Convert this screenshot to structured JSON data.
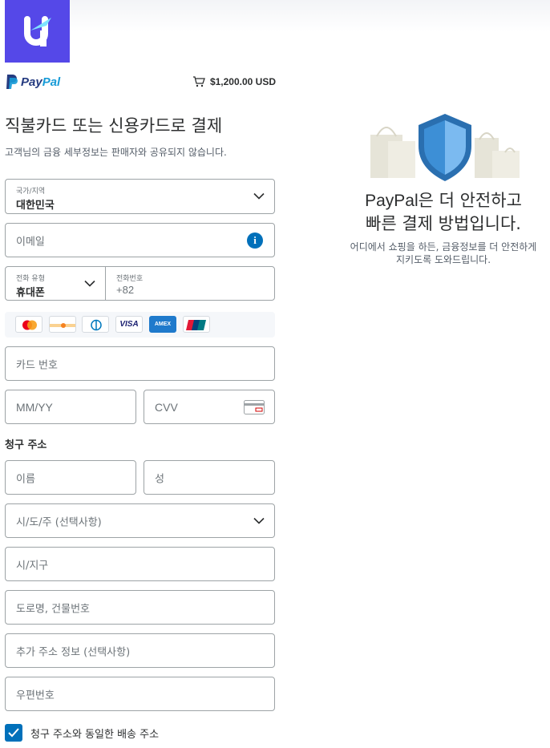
{
  "brand": {
    "logo_icon": "u-logo-icon",
    "accent": "#5548e8"
  },
  "paypal": {
    "logo_text_a": "Pay",
    "logo_text_b": "Pal",
    "amount": "$1,200.00 USD",
    "cart_icon": "cart-icon"
  },
  "form": {
    "title": "직불카드 또는 신용카드로 결제",
    "subtitle": "고객님의 금융 세부정보는 판매자와 공유되지 않습니다.",
    "country": {
      "label": "국가/지역",
      "value": "대한민국"
    },
    "email": {
      "placeholder": "이메일"
    },
    "phone_type": {
      "label": "전화 유형",
      "value": "휴대폰"
    },
    "phone_number": {
      "label": "전화번호",
      "value": "+82"
    },
    "card_logos": [
      {
        "name": "mastercard"
      },
      {
        "name": "discover"
      },
      {
        "name": "diners-club"
      },
      {
        "name": "visa",
        "text": "VISA"
      },
      {
        "name": "amex",
        "text": "AMEX"
      },
      {
        "name": "unionpay"
      }
    ],
    "card_number": {
      "placeholder": "카드 번호"
    },
    "expiry": {
      "placeholder": "MM/YY"
    },
    "cvv": {
      "placeholder": "CVV"
    },
    "billing_label": "청구 주소",
    "first_name": {
      "placeholder": "이름"
    },
    "last_name": {
      "placeholder": "성"
    },
    "state": {
      "placeholder": "시/도/주 (선택사항)"
    },
    "city": {
      "placeholder": "시/지구"
    },
    "street": {
      "placeholder": "도로명, 건물번호"
    },
    "extra_address": {
      "placeholder": "추가 주소 정보 (선택사항)"
    },
    "postal": {
      "placeholder": "우편번호"
    },
    "same_shipping": {
      "label": "청구 주소와 동일한 배송 주소",
      "checked": true
    }
  },
  "side_panel": {
    "title_en": "PayPal",
    "title_line1": "은 더 안전하고",
    "title_line2": "빠른 결제 방법입니다.",
    "description": "어디에서 쇼핑을 하든, 금융정보를 더 안전하게 지키도록 도와드립니다."
  },
  "colors": {
    "paypal_blue": "#0070ba",
    "paypal_dark": "#253b80",
    "paypal_light": "#179bd7"
  }
}
